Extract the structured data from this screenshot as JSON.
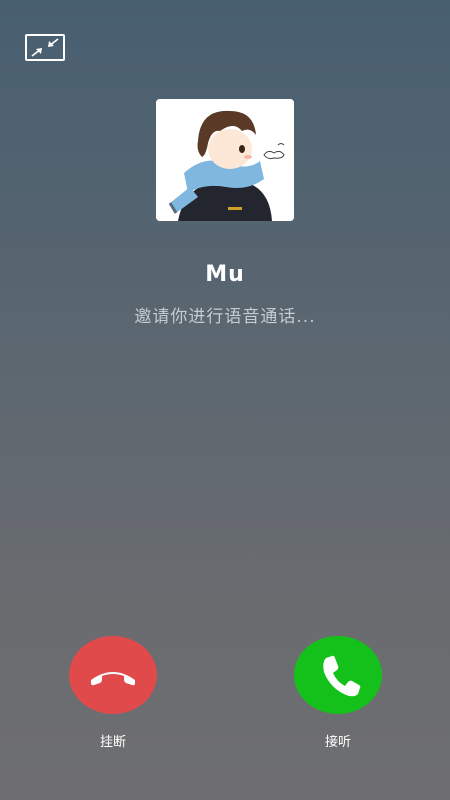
{
  "caller": {
    "name": "Mu",
    "status": "邀请你进行语音通话..."
  },
  "actions": {
    "hangup_label": "挂断",
    "answer_label": "接听"
  },
  "icons": {
    "minimize": "minimize-window-icon",
    "hangup": "phone-hangup-icon",
    "answer": "phone-answer-icon"
  },
  "colors": {
    "hangup": "#e04a4a",
    "answer": "#14c11a"
  }
}
